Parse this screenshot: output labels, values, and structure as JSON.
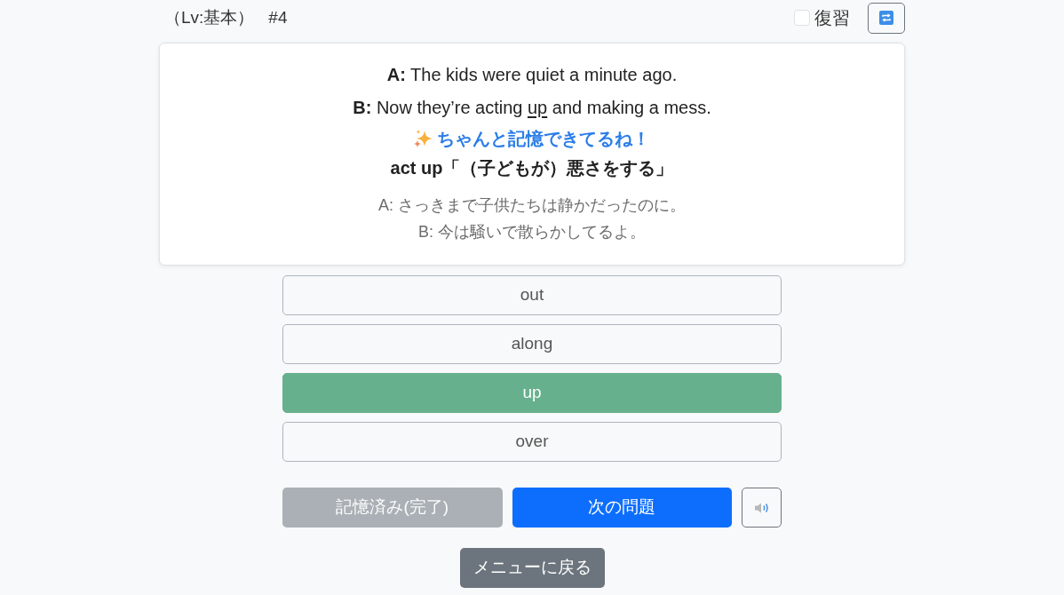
{
  "header": {
    "level": "（Lv:基本）",
    "number": "#4",
    "review": {
      "label": "復習",
      "checked": false
    }
  },
  "dialogue": [
    {
      "speaker": "A:",
      "parts": [
        {
          "text": "The kids were quiet a minute ago.",
          "underlined": false
        }
      ]
    },
    {
      "speaker": "B:",
      "parts": [
        {
          "text": "Now they’re acting ",
          "underlined": false
        },
        {
          "text": "up",
          "underlined": true
        },
        {
          "text": " and making a mess.",
          "underlined": false
        }
      ]
    }
  ],
  "feedback": {
    "kind": "correct",
    "message": "ちゃんと記憶できてるね！"
  },
  "meaning": "act up「（子どもが）悪さをする」",
  "translation": [
    "A: さっきまで子供たちは静かだったのに。",
    "B: 今は騒いで散らかしてるよ。"
  ],
  "choices": [
    {
      "label": "out",
      "selected": false
    },
    {
      "label": "along",
      "selected": false
    },
    {
      "label": "up",
      "selected": true
    },
    {
      "label": "over",
      "selected": false
    }
  ],
  "actions": [
    {
      "label": "記憶済み(完了)",
      "kind": "secondary",
      "disabled": true
    },
    {
      "label": "次の問題",
      "kind": "primary",
      "disabled": false
    }
  ],
  "menu_button": "メニューに戻る"
}
